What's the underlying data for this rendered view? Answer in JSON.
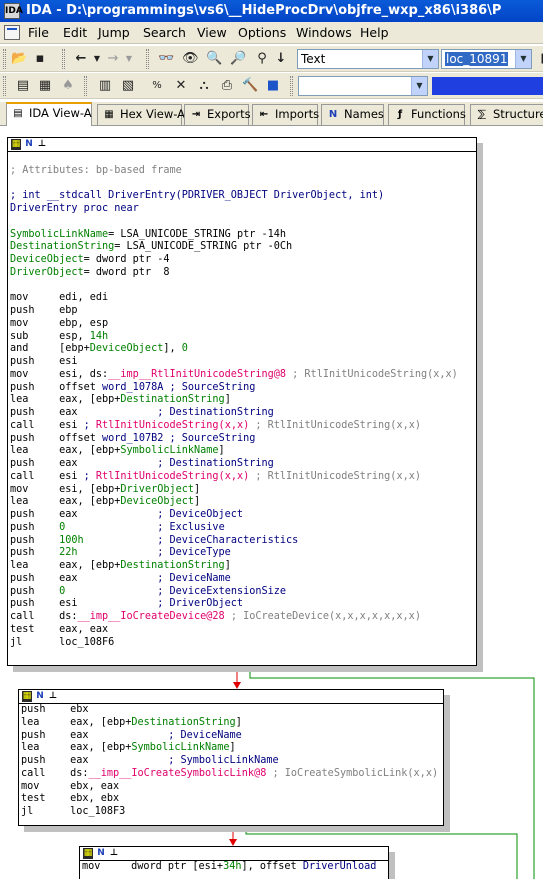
{
  "window": {
    "title": "IDA - D:\\programmings\\vs6\\__HideProcDrv\\objfre_wxp_x86\\i386\\P"
  },
  "menu": [
    "File",
    "Edit",
    "Jump",
    "Search",
    "View",
    "Options",
    "Windows",
    "Help"
  ],
  "toolbar": {
    "type_combo": "Text",
    "location_combo": "loc_10891"
  },
  "tabs": [
    {
      "label": "IDA View-A",
      "icon": "ida-view-icon"
    },
    {
      "label": "Hex View-A",
      "icon": "hex-view-icon"
    },
    {
      "label": "Exports",
      "icon": "exports-icon"
    },
    {
      "label": "Imports",
      "icon": "imports-icon"
    },
    {
      "label": "Names",
      "icon": "names-icon"
    },
    {
      "label": "Functions",
      "icon": "functions-icon"
    },
    {
      "label": "Structures",
      "icon": "structures-icon"
    }
  ],
  "node1": {
    "lines": [
      "",
      "; Attributes: bp-based frame",
      "",
      "; int __stdcall DriverEntry(PDRIVER_OBJECT DriverObject, int)",
      "DriverEntry proc near",
      "",
      "SymbolicLinkName= LSA_UNICODE_STRING ptr -14h",
      "DestinationString= LSA_UNICODE_STRING ptr -0Ch",
      "DeviceObject= dword ptr -4",
      "DriverObject= dword ptr  8",
      "",
      "mov     edi, edi",
      "push    ebp",
      "mov     ebp, esp",
      "sub     esp, 14h",
      "and     [ebp+DeviceObject], 0",
      "push    esi",
      "mov     esi, ds:__imp__RtlInitUnicodeString@8 ; RtlInitUnicodeString(x,x)",
      "push    offset word_1078A ; SourceString",
      "lea     eax, [ebp+DestinationString]",
      "push    eax             ; DestinationString",
      "call    esi ; RtlInitUnicodeString(x,x) ; RtlInitUnicodeString(x,x)",
      "push    offset word_107B2 ; SourceString",
      "lea     eax, [ebp+SymbolicLinkName]",
      "push    eax             ; DestinationString",
      "call    esi ; RtlInitUnicodeString(x,x) ; RtlInitUnicodeString(x,x)",
      "mov     esi, [ebp+DriverObject]",
      "lea     eax, [ebp+DeviceObject]",
      "push    eax             ; DeviceObject",
      "push    0               ; Exclusive",
      "push    100h            ; DeviceCharacteristics",
      "push    22h             ; DeviceType",
      "lea     eax, [ebp+DestinationString]",
      "push    eax             ; DeviceName",
      "push    0               ; DeviceExtensionSize",
      "push    esi             ; DriverObject",
      "call    ds:__imp__IoCreateDevice@28 ; IoCreateDevice(x,x,x,x,x,x,x)",
      "test    eax, eax",
      "jl      loc_108F6"
    ]
  },
  "node2": {
    "lines": [
      "push    ebx",
      "lea     eax, [ebp+DestinationString]",
      "push    eax             ; DeviceName",
      "lea     eax, [ebp+SymbolicLinkName]",
      "push    eax             ; SymbolicLinkName",
      "call    ds:__imp__IoCreateSymbolicLink@8 ; IoCreateSymbolicLink(x,x)",
      "mov     ebx, eax",
      "test    ebx, ebx",
      "jl      loc_108F3"
    ]
  },
  "node3": {
    "lines": [
      "mov     dword ptr [esi+34h], offset DriverUnload"
    ]
  },
  "colors": {
    "comment": "#808080",
    "declaration": "#000080",
    "stack_var": "#008000",
    "import": "#e0006c",
    "edge_red": "#e00000",
    "edge_green": "#009000"
  }
}
